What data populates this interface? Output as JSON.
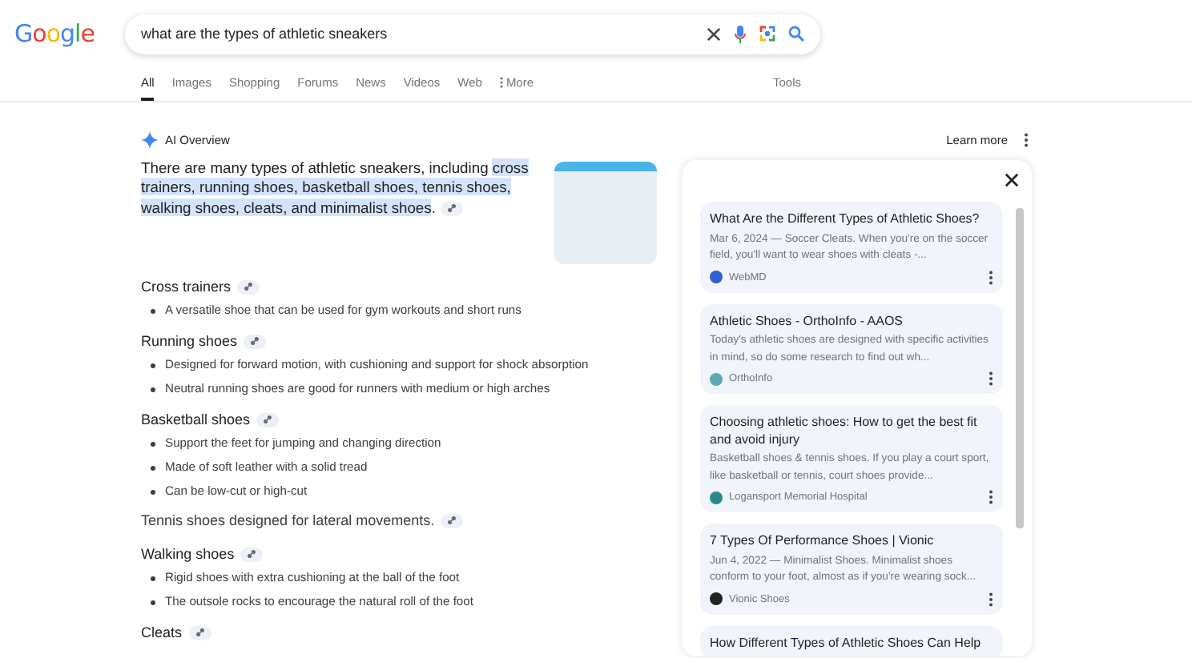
{
  "logo": "Google",
  "search": {
    "value": "what are the types of athletic sneakers"
  },
  "tabs": [
    {
      "label": "All",
      "selected": true
    },
    {
      "label": "Images",
      "selected": false
    },
    {
      "label": "Shopping",
      "selected": false
    },
    {
      "label": "Forums",
      "selected": false
    },
    {
      "label": "News",
      "selected": false
    },
    {
      "label": "Videos",
      "selected": false
    },
    {
      "label": "Web",
      "selected": false
    },
    {
      "label": "More",
      "selected": false
    }
  ],
  "tools": "Tools",
  "ai_overview": {
    "title": "AI Overview",
    "learn_more": "Learn more",
    "intro": {
      "text": "There are many types of athletic sneakers, including ",
      "highlighted": "cross trainers, running shoes, basketball shoes, tennis shoes, walking shoes, cleats, and minimalist shoes",
      "end": "."
    },
    "sections": [
      {
        "kind": "heading",
        "text": "Cross trainers",
        "bullets": [
          "A versatile shoe that can be used for gym workouts and short runs"
        ]
      },
      {
        "kind": "heading",
        "text": "Running shoes",
        "bullets": [
          "Designed for forward motion, with cushioning and support for shock absorption",
          "Neutral running shoes are good for runners with medium or high arches"
        ]
      },
      {
        "kind": "heading",
        "text": "Basketball shoes",
        "bullets": [
          "Support the feet for jumping and changing direction",
          "Made of soft leather with a solid tread",
          "Can be low-cut or high-cut"
        ]
      },
      {
        "kind": "paragraph",
        "text": "Tennis shoes designed for lateral movements."
      },
      {
        "kind": "heading",
        "text": "Walking shoes",
        "bullets": [
          "Rigid shoes with extra cushioning at the ball of the foot",
          "The outsole rocks to encourage the natural roll of the foot"
        ]
      },
      {
        "kind": "heading",
        "text": "Cleats"
      }
    ]
  },
  "sources": [
    {
      "title": "What Are the Different Types of Athletic Shoes?",
      "snippet": "Mar 6, 2024 — Soccer Cleats. When you're on the soccer field, you'll want to wear shoes with cleats -...",
      "site": "WebMD",
      "color": "#2f5fd0"
    },
    {
      "title": "Athletic Shoes - OrthoInfo - AAOS",
      "snippet": "Today's athletic shoes are designed with specific activities in mind, so do some research to find out wh...",
      "site": "OrthoInfo",
      "color": "#5aa7b8"
    },
    {
      "title": "Choosing athletic shoes: How to get the best fit and avoid injury",
      "snippet": "Basketball shoes & tennis shoes. If you play a court sport, like basketball or tennis, court shoes provide...",
      "site": "Logansport Memorial Hospital",
      "color": "#2a8a8a"
    },
    {
      "title": "7 Types Of Performance Shoes | Vionic",
      "snippet": "Jun 4, 2022 — Minimalist Shoes. Minimalist shoes conform to your foot, almost as if you're wearing sock...",
      "site": "Vionic Shoes",
      "color": "#222222"
    },
    {
      "title": "How Different Types of Athletic Shoes Can Help"
    }
  ]
}
